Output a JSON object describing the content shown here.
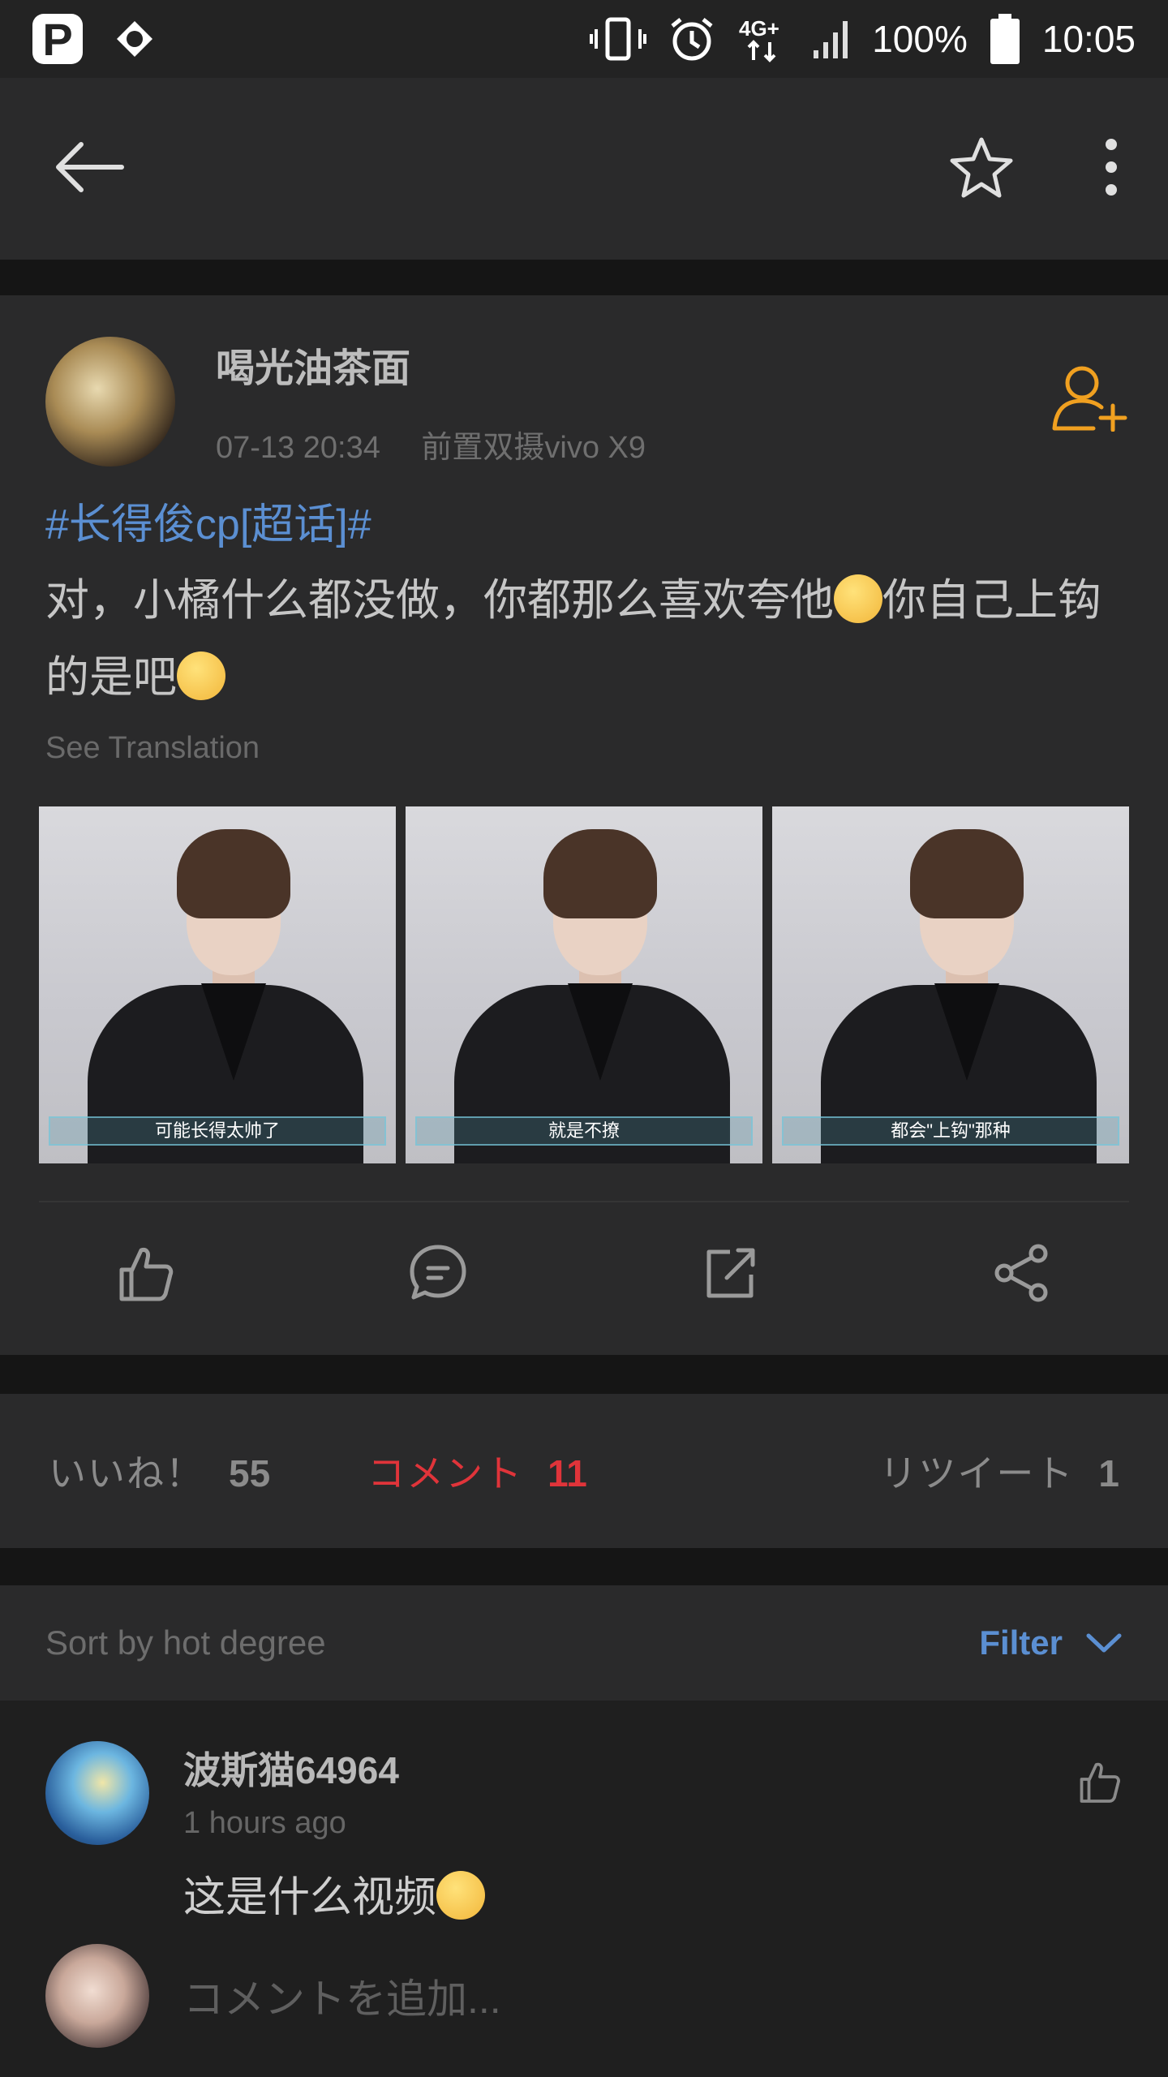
{
  "status_bar": {
    "battery": "100%",
    "time": "10:05",
    "network": "4G+",
    "icons": [
      "pinterest-like-app-icon",
      "app-icon",
      "vibrate-icon",
      "alarm-icon",
      "network-4g-icon",
      "signal-icon",
      "battery-icon"
    ]
  },
  "toolbar": {
    "back_icon": "back-arrow-icon",
    "star_icon": "star-icon",
    "more_icon": "more-vertical-icon"
  },
  "post": {
    "author": "喝光油茶面",
    "date": "07-13 20:34",
    "device": "前置双摄vivo X9",
    "hashtag": "#长得俊cp[超话]#",
    "text_part1": "对，小橘什么都没做，你都那么喜欢夸他",
    "text_part2": "你自己上钩的是吧",
    "see_translation": "See Translation",
    "photos": [
      {
        "caption": "可能长得太帅了"
      },
      {
        "caption": "就是不撩"
      },
      {
        "caption": "都会\"上钩\"那种"
      }
    ]
  },
  "stats": {
    "likes_label": "いいね！",
    "likes_count": "55",
    "comments_label": "コメント",
    "comments_count": "11",
    "retweets_label": "リツイート",
    "retweets_count": "1"
  },
  "sort": {
    "label": "Sort by hot degree",
    "filter_label": "Filter"
  },
  "comments": [
    {
      "user": "波斯猫64964",
      "time": "1 hours ago",
      "text": "这是什么视频"
    }
  ],
  "composer": {
    "placeholder": "コメントを追加..."
  },
  "colors": {
    "accent_blue": "#5b8fd2",
    "accent_red": "#e0343a",
    "follow_orange": "#f0a020",
    "background": "#1f1f1f",
    "card": "#2a2a2b"
  }
}
